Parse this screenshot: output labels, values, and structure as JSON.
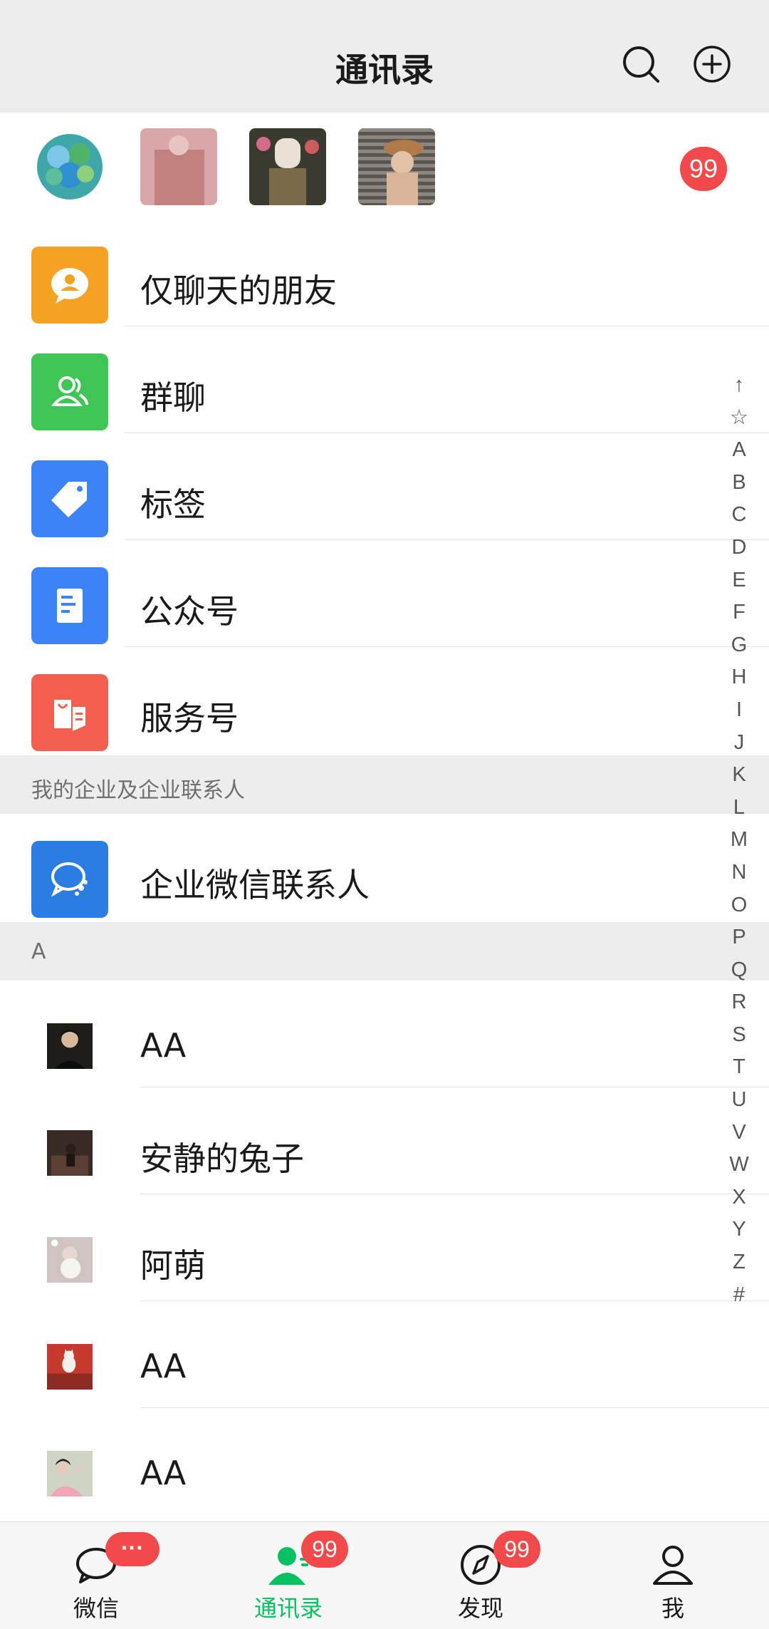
{
  "header": {
    "title": "通讯录"
  },
  "recent": {
    "badge": "99"
  },
  "menu": [
    {
      "label": "仅聊天的朋友",
      "color": "#f5a123",
      "icon": "chat-only-friend-icon"
    },
    {
      "label": "群聊",
      "color": "#3fc456",
      "icon": "group-chat-icon"
    },
    {
      "label": "标签",
      "color": "#3b83f6",
      "icon": "tag-icon"
    },
    {
      "label": "公众号",
      "color": "#3b83f6",
      "icon": "official-account-icon"
    },
    {
      "label": "服务号",
      "color": "#f35f4f",
      "icon": "service-account-icon"
    }
  ],
  "enterprise": {
    "section_title": "我的企业及企业联系人",
    "item_label": "企业微信联系人",
    "color": "#2a7de1"
  },
  "contacts_section": {
    "title": "A"
  },
  "contacts": [
    {
      "name": "AA"
    },
    {
      "name": "安静的兔子"
    },
    {
      "name": "阿萌"
    },
    {
      "name": "AA"
    },
    {
      "name": "AA"
    }
  ],
  "index": [
    "↑",
    "☆",
    "A",
    "B",
    "C",
    "D",
    "E",
    "F",
    "G",
    "H",
    "I",
    "J",
    "K",
    "L",
    "M",
    "N",
    "O",
    "P",
    "Q",
    "R",
    "S",
    "T",
    "U",
    "V",
    "W",
    "X",
    "Y",
    "Z",
    "#"
  ],
  "tabbar": {
    "tabs": [
      {
        "label": "微信",
        "badge": "···"
      },
      {
        "label": "通讯录",
        "badge": "99"
      },
      {
        "label": "发现",
        "badge": "99"
      },
      {
        "label": "我",
        "badge": ""
      }
    ],
    "active_color": "#07c160"
  }
}
